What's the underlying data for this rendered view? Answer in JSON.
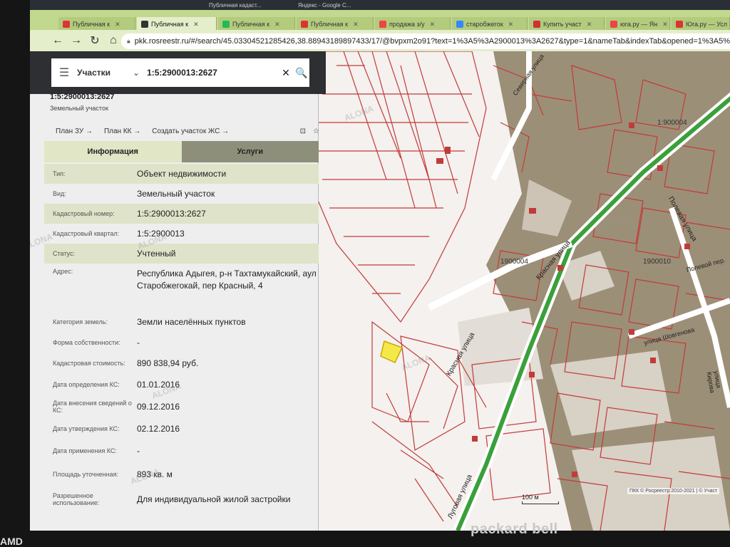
{
  "browser": {
    "tabs": [
      {
        "label": "Публичная к",
        "color": "#d33"
      },
      {
        "label": "Публичная к",
        "color": "#333",
        "active": true
      },
      {
        "label": "Публичная к",
        "color": "#2b5"
      },
      {
        "label": "Публичная к",
        "color": "#d33"
      },
      {
        "label": "продажа з/у",
        "color": "#e44"
      },
      {
        "label": "старобжегок",
        "color": "#38f"
      },
      {
        "label": "Купить участ",
        "color": "#c33"
      },
      {
        "label": "юга.ру — Ян",
        "color": "#e44"
      },
      {
        "label": "Юга.ру — Усл",
        "color": "#d33"
      }
    ],
    "os_tabs": [
      {
        "label": "Публичная кадаст..."
      },
      {
        "label": "Яндекс - Google С..."
      }
    ],
    "url": "pkk.rosreestr.ru/#/search/45.03304521285426,38.88943189897433/17/@bvpxm2o91?text=1%3A5%3A2900013%3A2627&type=1&nameTab&indexTab&opened=1%3A5%"
  },
  "search": {
    "type_label": "Участки",
    "query": "1:5:2900013:2627"
  },
  "object": {
    "number": "1:5:2900013:2627",
    "subtitle": "Земельный участок",
    "links": [
      "План ЗУ →",
      "План КК →",
      "Создать участок ЖС →"
    ],
    "tab_info": "Информация",
    "tab_services": "Услуги",
    "rows": [
      {
        "k": "Тип:",
        "v": "Объект недвижимости"
      },
      {
        "k": "Вид:",
        "v": "Земельный участок"
      },
      {
        "k": "Кадастровый номер:",
        "v": "1:5:2900013:2627"
      },
      {
        "k": "Кадастровый квартал:",
        "v": "1:5:2900013"
      },
      {
        "k": "Статус:",
        "v": "Учтенный"
      },
      {
        "k": "Адрес:",
        "v": "Республика Адыгея, р-н Тахтамукайский, аул Старобжегокай, пер Красный, 4"
      },
      {
        "k": "Категория земель:",
        "v": "Земли населённых пунктов"
      },
      {
        "k": "Форма собственности:",
        "v": "-"
      },
      {
        "k": "Кадастровая стоимость:",
        "v": "890 838,94 руб."
      },
      {
        "k": "Дата определения КС:",
        "v": "01.01.2016"
      },
      {
        "k": "Дата внесения сведений о КС:",
        "v": "09.12.2016"
      },
      {
        "k": "Дата утверждения КС:",
        "v": "02.12.2016"
      },
      {
        "k": "Дата применения КС:",
        "v": "-"
      },
      {
        "k": "Площадь уточненная:",
        "v": "893 кв. м"
      },
      {
        "k": "Разрешенное использование:",
        "v": "Для индивидуальной жилой застройки"
      }
    ]
  },
  "map": {
    "labels": [
      "Красная улица",
      "Полевая улица",
      "Полевой пер.",
      "улица Шовгенова",
      "улица Кирова",
      "Луговая улица",
      "Северная улица",
      "1900004",
      "1900010",
      "1:900004"
    ],
    "scale": "100 м",
    "attribution": "ПКК © Росреестр 2010-2021 | © Участ"
  },
  "device": {
    "brand": "packard bell",
    "amd": "AMD"
  },
  "watermark": "ALONA"
}
